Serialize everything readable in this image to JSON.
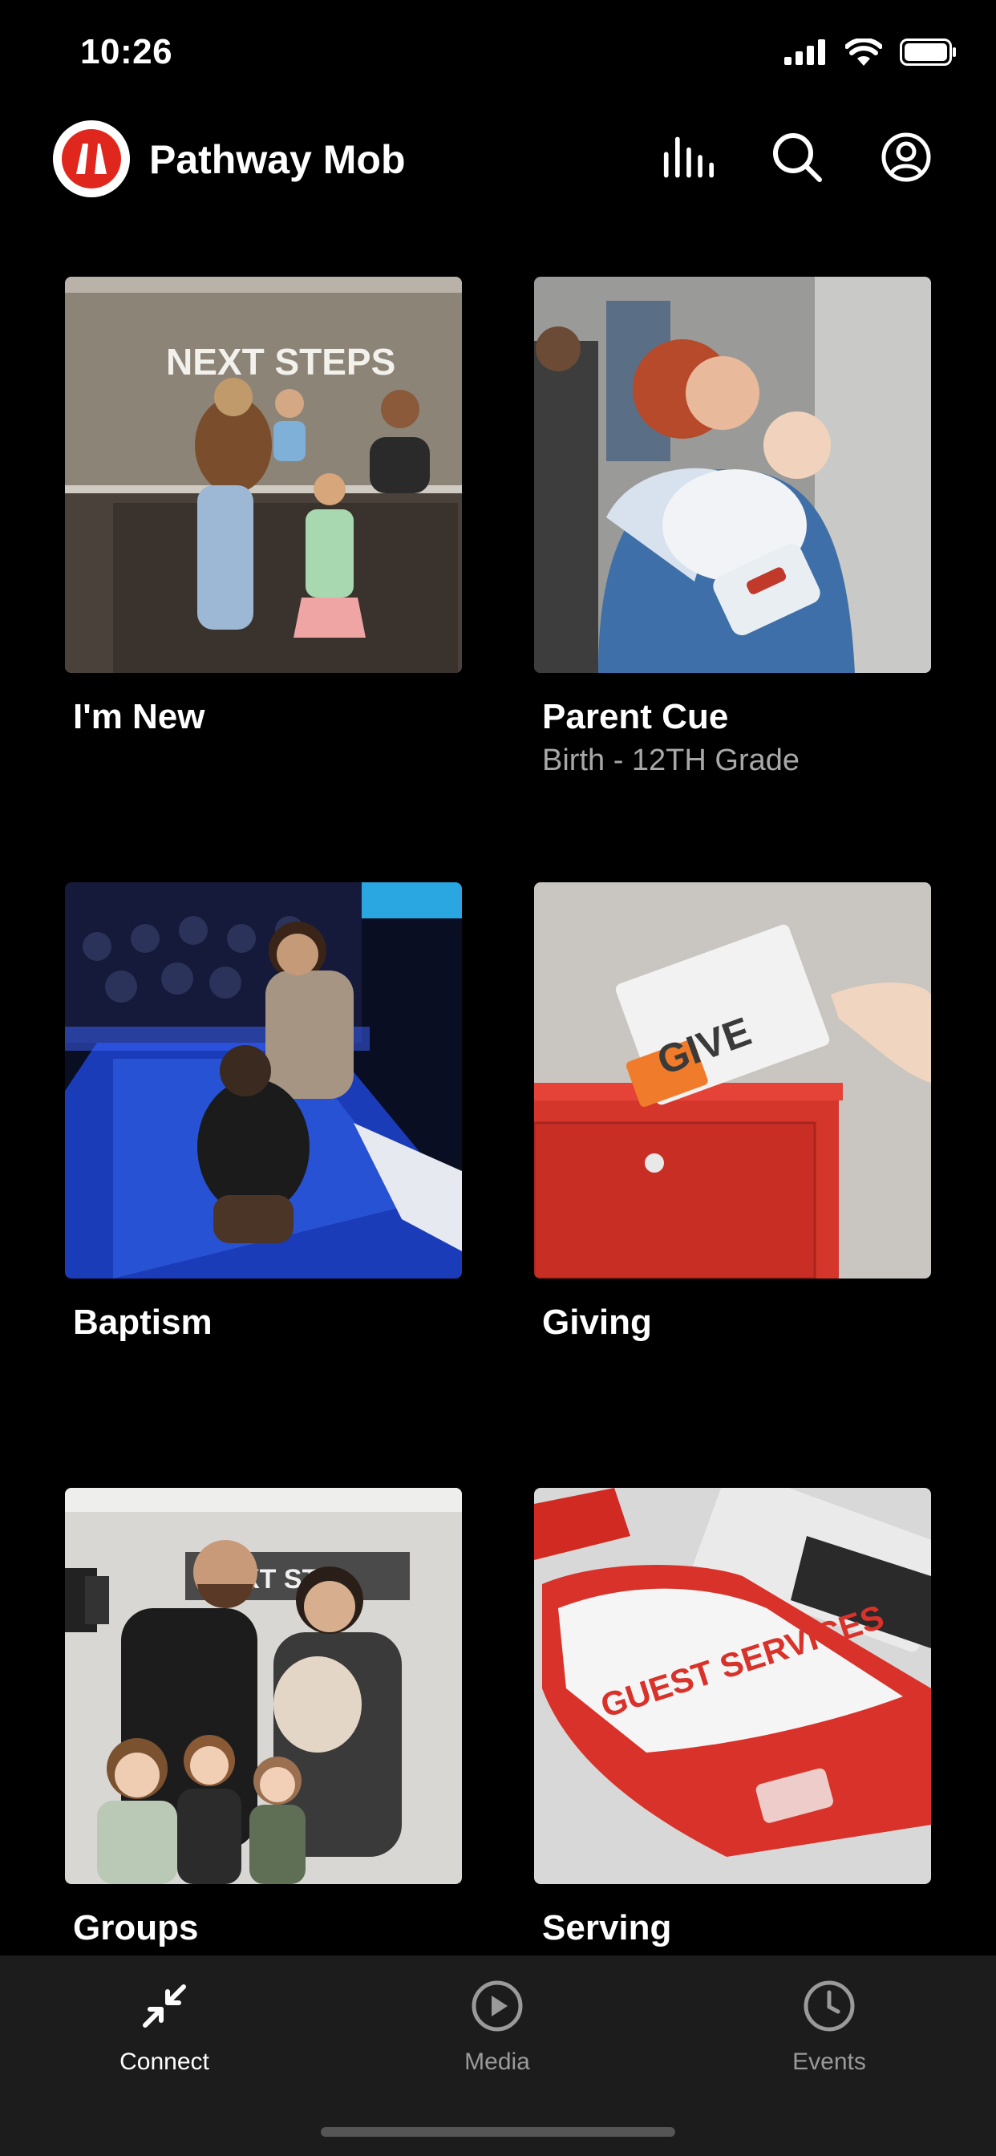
{
  "status_bar": {
    "time": "10:26"
  },
  "header": {
    "app_name": "Pathway Mob",
    "brand_color": "#e0271e"
  },
  "tiles": [
    {
      "title": "I'm New",
      "subtitle": "",
      "image_text": "NEXT STEPS"
    },
    {
      "title": "Parent Cue",
      "subtitle": "Birth - 12TH Grade",
      "image_text": ""
    },
    {
      "title": "Baptism",
      "subtitle": "",
      "image_text": ""
    },
    {
      "title": "Giving",
      "subtitle": "",
      "image_text": "GIVE"
    },
    {
      "title": "Groups",
      "subtitle": "",
      "image_text": "XT ST"
    },
    {
      "title": "Serving",
      "subtitle": "",
      "image_text": "GUEST SERVICES"
    }
  ],
  "tabbar": {
    "tabs": [
      {
        "label": "Connect",
        "icon": "connect-icon",
        "active": true
      },
      {
        "label": "Media",
        "icon": "play-icon",
        "active": false
      },
      {
        "label": "Events",
        "icon": "clock-icon",
        "active": false
      }
    ]
  }
}
